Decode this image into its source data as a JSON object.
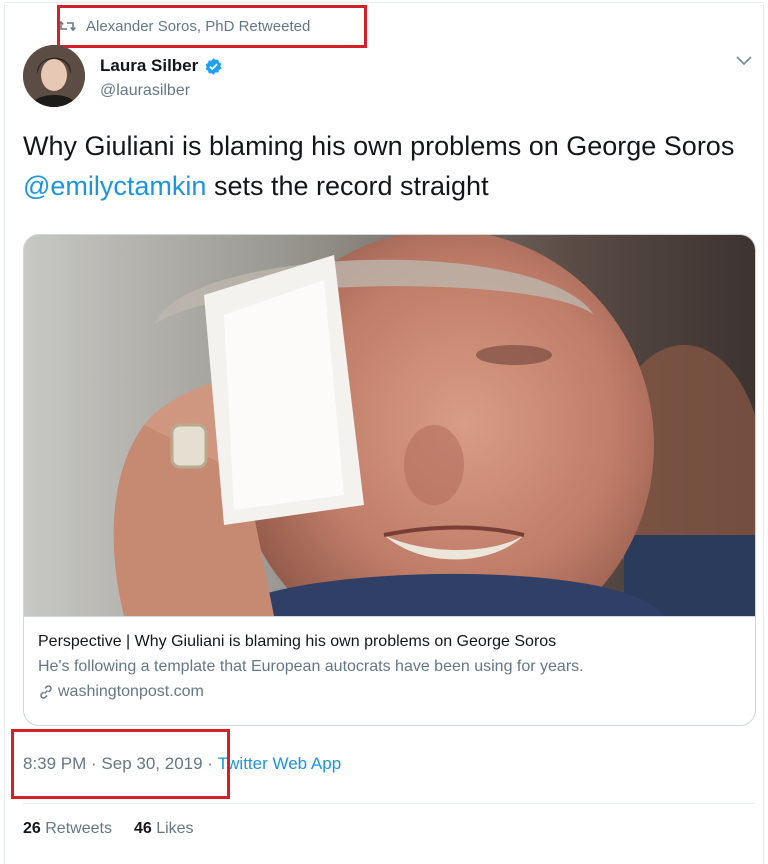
{
  "retweet": {
    "text": "Alexander Soros, PhD Retweeted"
  },
  "author": {
    "name": "Laura Silber",
    "handle": "@laurasilber"
  },
  "tweet": {
    "text_before": "Why Giuliani is blaming his own problems on George Soros ",
    "mention": "@emilyctamkin",
    "text_after": " sets the record straight"
  },
  "card": {
    "image_label": "Photo",
    "title": "Perspective | Why Giuliani is blaming his own problems on George Soros",
    "description": "He's following a template that European autocrats have been using for years.",
    "domain": "washingtonpost.com",
    "link_icon": "link-icon"
  },
  "meta": {
    "time": "8:39 PM",
    "separator1": " · ",
    "date": "Sep 30, 2019",
    "separator2": " · ",
    "app": "Twitter Web App"
  },
  "stats": {
    "retweets_count": "26",
    "retweets_label": "Retweets",
    "likes_count": "46",
    "likes_label": "Likes"
  },
  "colors": {
    "accent": "#1b95e0",
    "highlight": "#d5202a",
    "muted": "#657786"
  }
}
